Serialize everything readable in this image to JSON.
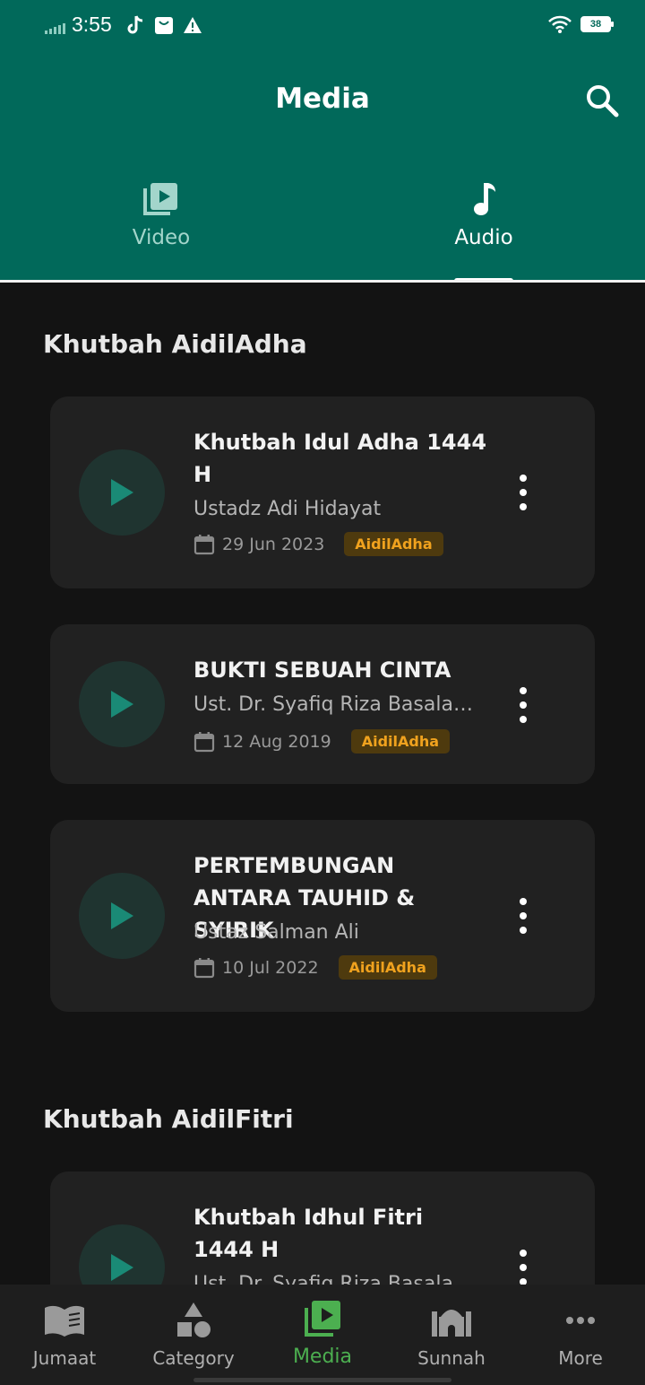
{
  "status_bar": {
    "time": "3:55",
    "battery": "38"
  },
  "header": {
    "title": "Media"
  },
  "tabs": [
    {
      "label": "Video",
      "icon": "video-library-icon",
      "active": false
    },
    {
      "label": "Audio",
      "icon": "music-note-icon",
      "active": true
    }
  ],
  "sections": [
    {
      "title": "Khutbah AidilAdha",
      "items": [
        {
          "title": "Khutbah Idul Adha 1444 H",
          "speaker": "Ustadz Adi Hidayat",
          "date": "29 Jun 2023",
          "tag": "AidilAdha"
        },
        {
          "title": "BUKTI SEBUAH CINTA",
          "speaker": "Ust. Dr. Syafiq Riza Basalamah",
          "date": "12 Aug 2019",
          "tag": "AidilAdha"
        },
        {
          "title": "PERTEMBUNGAN ANTARA TAUHID & SYIRIK",
          "speaker": "Ustaz Salman Ali",
          "date": "10 Jul 2022",
          "tag": "AidilAdha"
        }
      ]
    },
    {
      "title": "Khutbah AidilFitri",
      "items": [
        {
          "title": "Khutbah Idhul Fitri 1444 H",
          "speaker": "Ust. Dr. Syafiq Riza Basalamah",
          "date": "",
          "tag": ""
        }
      ]
    }
  ],
  "bottom_nav": [
    {
      "label": "Jumaat",
      "icon": "book-icon",
      "active": false
    },
    {
      "label": "Category",
      "icon": "shapes-icon",
      "active": false
    },
    {
      "label": "Media",
      "icon": "video-library-icon",
      "active": true
    },
    {
      "label": "Sunnah",
      "icon": "mosque-icon",
      "active": false
    },
    {
      "label": "More",
      "icon": "more-horizontal-icon",
      "active": false
    }
  ],
  "colors": {
    "primary": "#01695a",
    "background": "#131313",
    "card": "#212121",
    "tag_text": "#f0a21e",
    "active_nav": "#4caf50"
  }
}
